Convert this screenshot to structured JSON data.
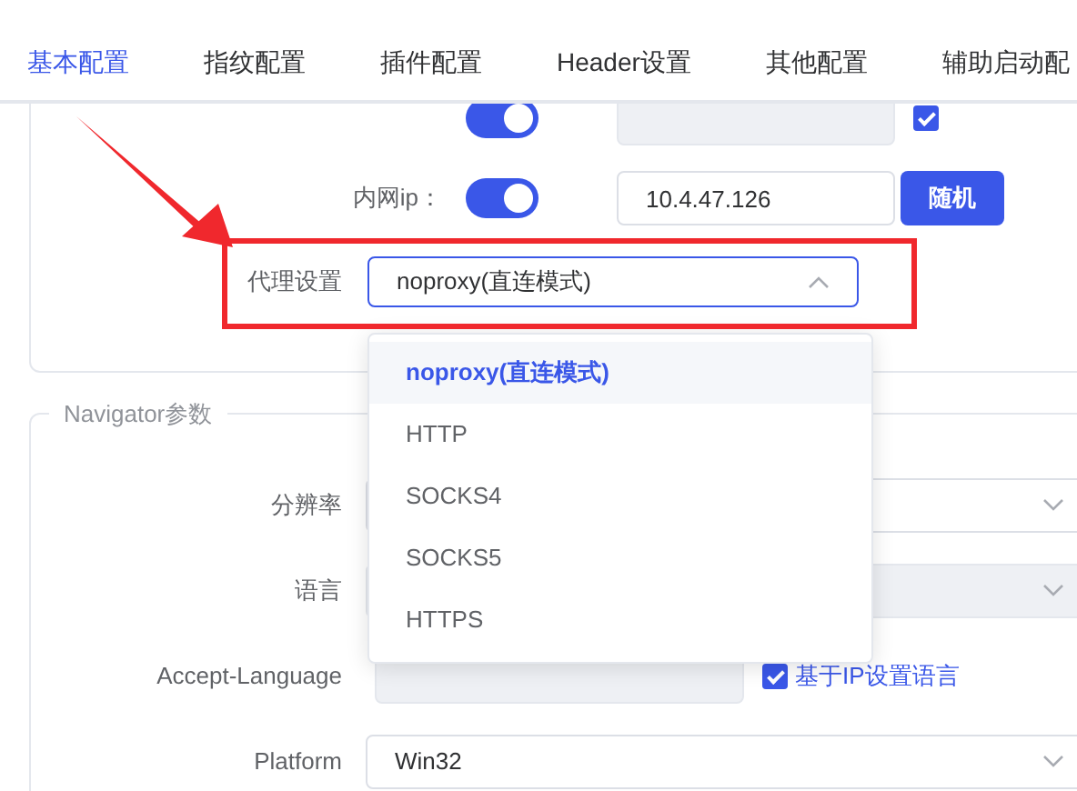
{
  "tabs": [
    {
      "label": "基本配置",
      "selected": true
    },
    {
      "label": "指纹配置",
      "selected": false
    },
    {
      "label": "插件配置",
      "selected": false
    },
    {
      "label": "Header设置",
      "selected": false
    },
    {
      "label": "其他配置",
      "selected": false
    },
    {
      "label": "辅助启动配",
      "selected": false
    }
  ],
  "network": {
    "rows": [
      {
        "toggle_on": true,
        "field_disabled": true,
        "checkbox_checked": true
      },
      {
        "label": "内网ip：",
        "toggle_on": true,
        "value": "10.4.47.126",
        "field_disabled": false,
        "button": "随机"
      }
    ]
  },
  "proxy": {
    "label": "代理设置",
    "value": "noproxy(直连模式)",
    "open": true,
    "options": [
      {
        "label": "noproxy(直连模式)",
        "selected": true
      },
      {
        "label": "HTTP",
        "selected": false
      },
      {
        "label": "SOCKS4",
        "selected": false
      },
      {
        "label": "SOCKS5",
        "selected": false
      },
      {
        "label": "HTTPS",
        "selected": false
      }
    ]
  },
  "navigator": {
    "legend": "Navigator参数",
    "rows": [
      {
        "kind": "select",
        "label": "分辨率",
        "disabled": false
      },
      {
        "kind": "select",
        "label": "语言",
        "disabled": true
      },
      {
        "kind": "input",
        "label": "Accept-Language",
        "disabled": true,
        "checkbox_checked": true,
        "checkbox_label": "基于IP设置语言"
      },
      {
        "kind": "select",
        "label": "Platform",
        "value": "Win32",
        "disabled": false
      }
    ]
  }
}
